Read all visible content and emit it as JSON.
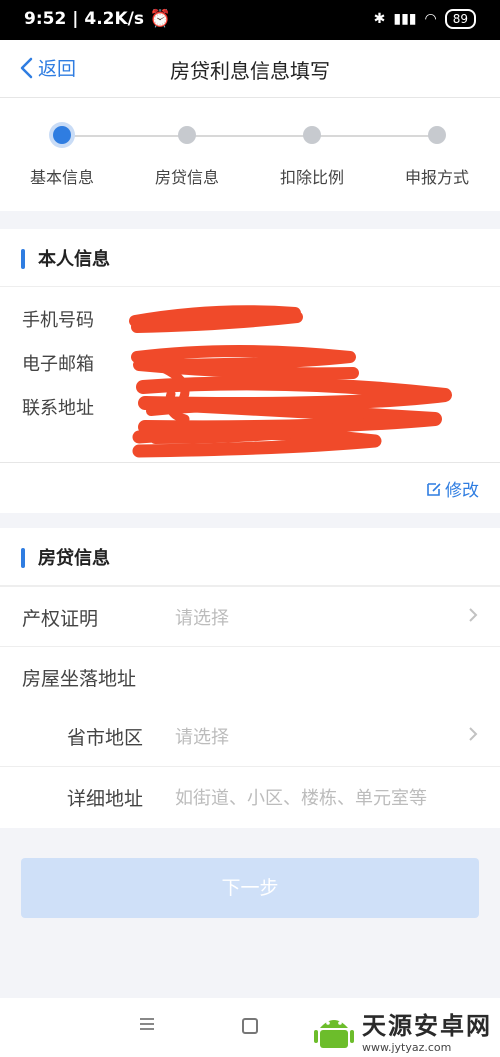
{
  "status": {
    "time": "9:52",
    "speed": "4.2K/s",
    "battery": "89"
  },
  "header": {
    "back_label": "返回",
    "title": "房贷利息信息填写"
  },
  "steps": [
    {
      "label": "基本信息",
      "active": true
    },
    {
      "label": "房贷信息",
      "active": false
    },
    {
      "label": "扣除比例",
      "active": false
    },
    {
      "label": "申报方式",
      "active": false
    }
  ],
  "personal": {
    "title": "本人信息",
    "phone_label": "手机号码",
    "email_label": "电子邮箱",
    "address_label": "联系地址",
    "edit_label": "修改"
  },
  "loan": {
    "title": "房贷信息",
    "property_label": "产权证明",
    "property_placeholder": "请选择",
    "location_label": "房屋坐落地址",
    "region_label": "省市地区",
    "region_placeholder": "请选择",
    "detail_label": "详细地址",
    "detail_placeholder": "如街道、小区、楼栋、单元室等"
  },
  "actions": {
    "next_label": "下一步"
  },
  "watermark": {
    "main": "天源安卓网",
    "sub": "www.jytyaz.com"
  },
  "colors": {
    "accent": "#2f7de1",
    "redaction": "#f04a2a"
  }
}
